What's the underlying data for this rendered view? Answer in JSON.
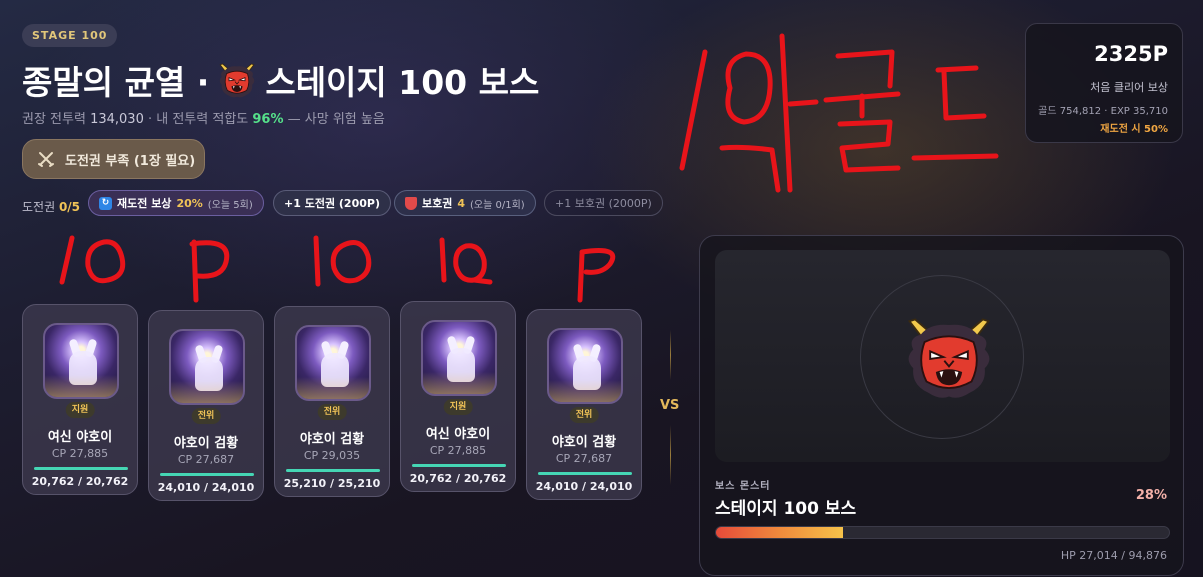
{
  "stage": {
    "badge": "STAGE 100",
    "title_prefix": "종말의 균열 ·",
    "title_suffix": "스테이지 100 보스",
    "sub_label1": "권장 전투력",
    "sub_value1": "134,030",
    "sub_label2": "· 내 전투력 적합도",
    "sub_pct": "96%",
    "sub_tail": "— 사망 위험 높음"
  },
  "ticket_button": {
    "label": "도전권 부족 (1장 필요)"
  },
  "ticket_row": {
    "label": "도전권",
    "count": "0/5",
    "retry_label": "재도전 보상",
    "retry_pct": "20%",
    "retry_today": "(오늘 5회)",
    "buy_ticket": "+1 도전권 (200P)",
    "shield_label": "보호권",
    "shield_count": "4",
    "shield_today": "(오늘 0/1회)",
    "buy_shield": "+1 보호권 (2000P)"
  },
  "reward": {
    "points": "2325P",
    "first_clear": "처음 클리어 보상",
    "gold_exp": "골드 754,812 · EXP 35,710",
    "retry_note": "재도전 시 50%"
  },
  "party": [
    {
      "role": "지원",
      "name": "여신 야호이",
      "cp": "CP 27,885",
      "hp": "20,762 / 20,762",
      "hp_ratio": 1.0
    },
    {
      "role": "전위",
      "name": "야호이 검황",
      "cp": "CP 27,687",
      "hp": "24,010 / 24,010",
      "hp_ratio": 1.0
    },
    {
      "role": "전위",
      "name": "야호이 검황",
      "cp": "CP 29,035",
      "hp": "25,210 / 25,210",
      "hp_ratio": 1.0
    },
    {
      "role": "지원",
      "name": "여신 야호이",
      "cp": "CP 27,885",
      "hp": "20,762 / 20,762",
      "hp_ratio": 1.0
    },
    {
      "role": "전위",
      "name": "야호이 검황",
      "cp": "CP 27,687",
      "hp": "24,010 / 24,010",
      "hp_ratio": 1.0
    }
  ],
  "vs_label": "VS",
  "boss": {
    "icon": "ogre-icon",
    "category": "보스 몬스터",
    "name": "스테이지 100 보스",
    "hp_pct_label": "28%",
    "hp_fraction": 0.28,
    "hp_text": "HP 27,014 / 94,876"
  },
  "colors": {
    "accent_gold": "#f0c357",
    "fit_green": "#55e08a",
    "hp_bar_teal": "#45d6b4",
    "annotation_red": "#e8141a"
  }
}
